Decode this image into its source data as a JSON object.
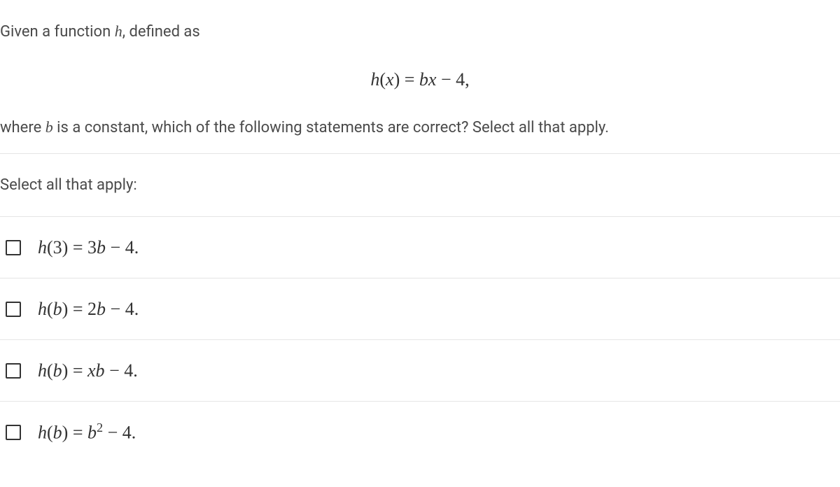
{
  "question": {
    "intro_before": "Given a function ",
    "intro_var": "h",
    "intro_after": ", defined as",
    "equation_html": "h(x) = bx − 4,",
    "trailing_before": "where ",
    "trailing_var": "b",
    "trailing_after": " is a constant, which of the following statements are correct? Select all that apply."
  },
  "instruction": "Select all that apply:",
  "options": [
    {
      "lhs_func": "h",
      "lhs_arg": "3",
      "rhs": "3b − 4",
      "sup": "",
      "argItalic": false
    },
    {
      "lhs_func": "h",
      "lhs_arg": "b",
      "rhs": "2b − 4",
      "sup": "",
      "argItalic": true
    },
    {
      "lhs_func": "h",
      "lhs_arg": "b",
      "rhs": "xb − 4",
      "sup": "",
      "argItalic": true
    },
    {
      "lhs_func": "h",
      "lhs_arg": "b",
      "rhs": "b² − 4",
      "sup": "",
      "argItalic": true
    }
  ]
}
